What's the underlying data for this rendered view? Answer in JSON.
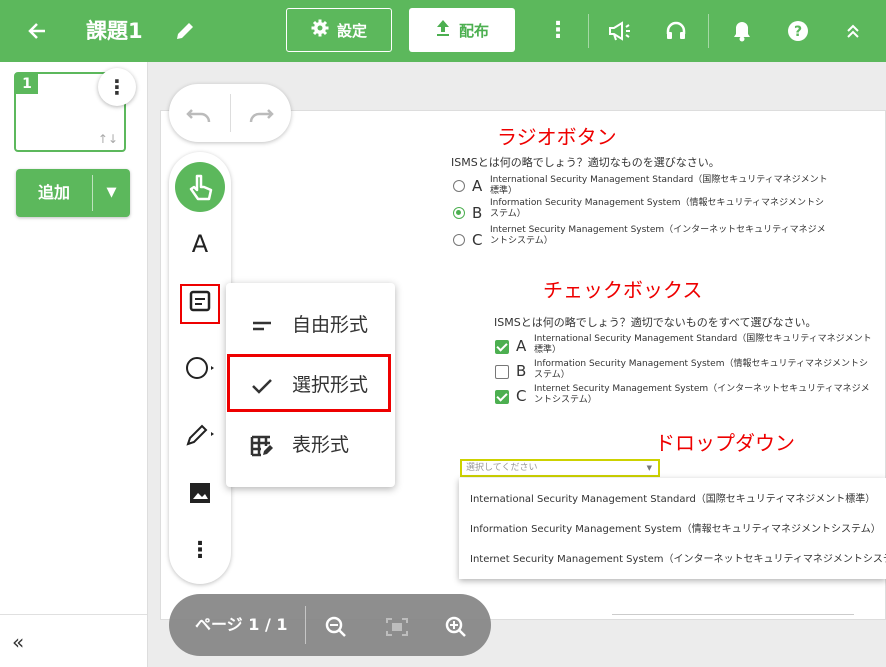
{
  "header": {
    "title": "課題1",
    "settings_label": "設定",
    "distribute_label": "配布",
    "icons": [
      "back-arrow-icon",
      "pencil-icon",
      "gear-icon",
      "upload-icon",
      "more-vert-icon",
      "megaphone-icon",
      "headset-icon",
      "bell-icon",
      "help-icon",
      "chevron-up-icon"
    ]
  },
  "sidebar": {
    "page_number": "1",
    "add_label": "追加",
    "collapse_label": "«"
  },
  "toolbar": {
    "text_tool_label": "A"
  },
  "question_type_menu": {
    "items": [
      {
        "label": "自由形式",
        "icon": "short-text-icon"
      },
      {
        "label": "選択形式",
        "icon": "check-icon"
      },
      {
        "label": "表形式",
        "icon": "table-edit-icon"
      }
    ],
    "selected": "選択形式"
  },
  "zoom": {
    "page_label": "ページ 1 / 1"
  },
  "canvas": {
    "radio_section": {
      "heading": "ラジオボタン",
      "question": "ISMSとは何の略でしょう？適切なものを選びなさい。",
      "options": [
        {
          "letter": "A",
          "line1": "International Security Management Standard（国際セキュリティマネジメント",
          "line2": "標準）",
          "selected": false
        },
        {
          "letter": "B",
          "line1": "Information Security Management System（情報セキュリティマネジメントシ",
          "line2": "ステム）",
          "selected": true
        },
        {
          "letter": "C",
          "line1": "Internet Security Management System（インターネットセキュリティマネジメ",
          "line2": "ントシステム）",
          "selected": false
        }
      ]
    },
    "checkbox_section": {
      "heading": "チェックボックス",
      "question": "ISMSとは何の略でしょう？適切でないものをすべて選びなさい。",
      "options": [
        {
          "letter": "A",
          "line1": "International Security Management Standard（国際セキュリティマネジメント",
          "line2": "標準）",
          "checked": true
        },
        {
          "letter": "B",
          "line1": "Information Security Management System（情報セキュリティマネジメントシ",
          "line2": "ステム）",
          "checked": false
        },
        {
          "letter": "C",
          "line1": "Internet Security Management System（インターネットセキュリティマネジメ",
          "line2": "ントシステム）",
          "checked": true
        }
      ]
    },
    "dropdown_section": {
      "heading": "ドロップダウン",
      "placeholder": "選択してください",
      "options": [
        "International Security Management Standard（国際セキュリティマネジメント標準）",
        "Information Security Management System（情報セキュリティマネジメントシステム）",
        "Internet Security Management System（インターネットセキュリティマネジメントシステム）"
      ]
    }
  },
  "colors": {
    "brand_green": "#5cb85c",
    "highlight_red": "#e00000",
    "dropdown_border": "#cdd200"
  }
}
